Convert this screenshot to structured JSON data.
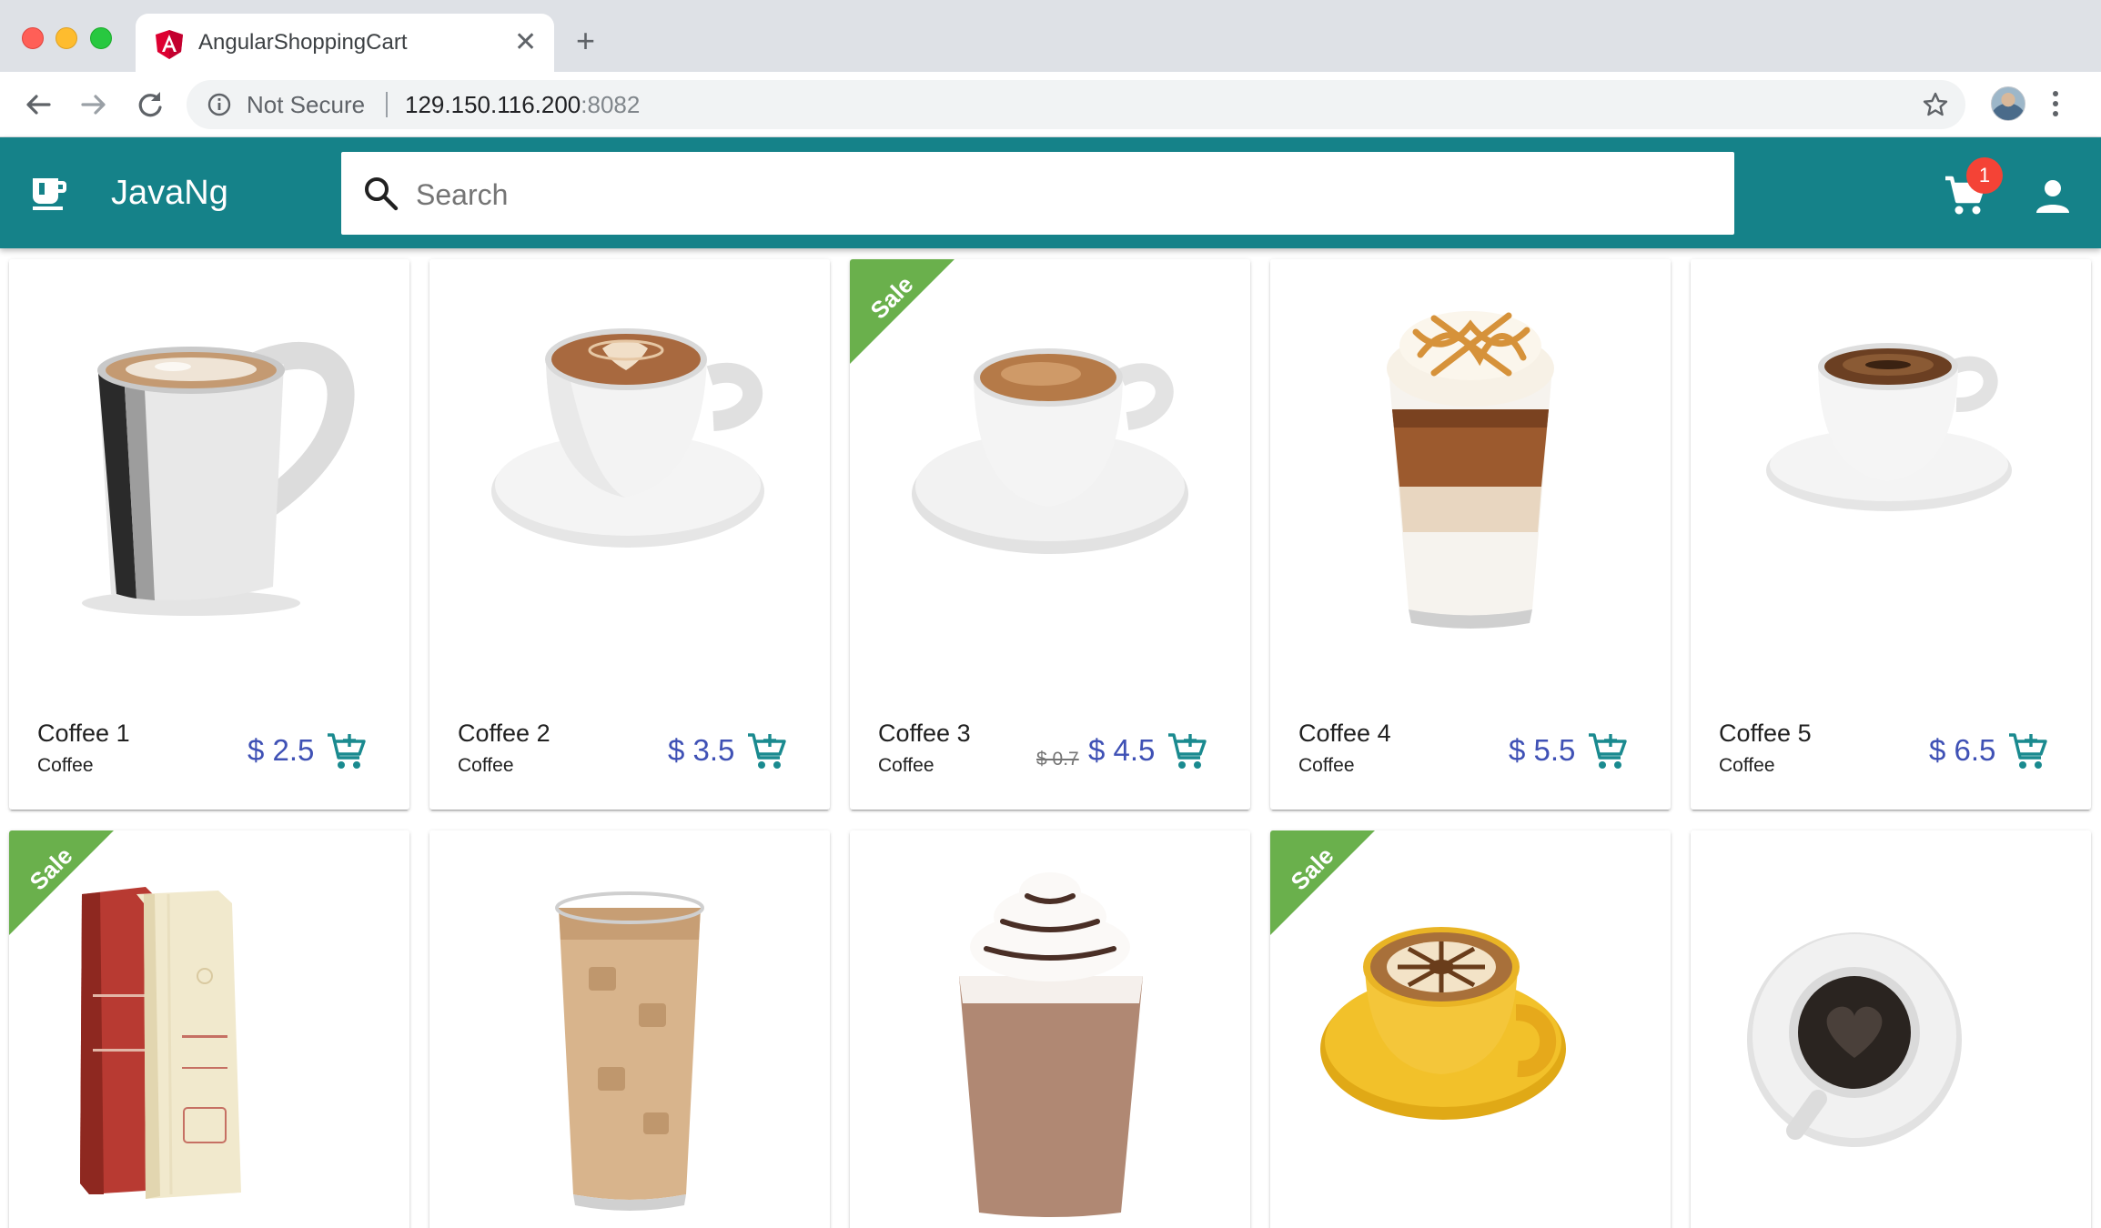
{
  "browser": {
    "tab_title": "AngularShoppingCart",
    "new_tab_symbol": "+",
    "close_symbol": "✕",
    "security_label": "Not Secure",
    "url_host": "129.150.116.200",
    "url_port": ":8082",
    "icons": [
      "back-icon",
      "forward-icon",
      "reload-icon",
      "info-icon",
      "star-icon",
      "profile-avatar",
      "more-vert-icon"
    ]
  },
  "app": {
    "title": "JavaNg",
    "logo_icon": "coffee-cup-icon",
    "search_placeholder": "Search",
    "cart_count": "1",
    "primary_color": "#158289",
    "price_color": "#3f51b5",
    "cart_icon_color": "#1a8a8f",
    "sale_color": "#6ab04c",
    "badge_color": "#f44336"
  },
  "products": [
    {
      "name": "Coffee 1",
      "category": "Coffee",
      "price": "$ 2.5",
      "old_price": "",
      "sale": false
    },
    {
      "name": "Coffee 2",
      "category": "Coffee",
      "price": "$ 3.5",
      "old_price": "",
      "sale": false
    },
    {
      "name": "Coffee 3",
      "category": "Coffee",
      "price": "$ 4.5",
      "old_price": "$ 0.7",
      "sale": true
    },
    {
      "name": "Coffee 4",
      "category": "Coffee",
      "price": "$ 5.5",
      "old_price": "",
      "sale": false
    },
    {
      "name": "Coffee 5",
      "category": "Coffee",
      "price": "$ 6.5",
      "old_price": "",
      "sale": false
    },
    {
      "sale": true
    },
    {
      "sale": false
    },
    {
      "sale": false
    },
    {
      "sale": true
    },
    {
      "sale": false
    }
  ],
  "sale_label": "Sale"
}
